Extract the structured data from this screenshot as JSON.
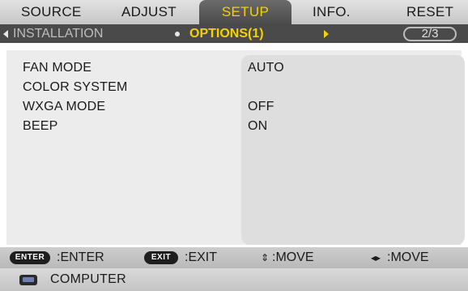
{
  "tabs": [
    {
      "label": "SOURCE",
      "active": false
    },
    {
      "label": "ADJUST",
      "active": false
    },
    {
      "label": "SETUP",
      "active": true
    },
    {
      "label": "INFO.",
      "active": false
    },
    {
      "label": "RESET",
      "active": false
    }
  ],
  "subtabs": {
    "prev": "INSTALLATION",
    "current": "OPTIONS(1)",
    "page": "2/3"
  },
  "settings": [
    {
      "label": "FAN MODE",
      "value": "AUTO"
    },
    {
      "label": "COLOR SYSTEM",
      "value": ""
    },
    {
      "label": "WXGA MODE",
      "value": "OFF"
    },
    {
      "label": "BEEP",
      "value": "ON"
    }
  ],
  "hints": {
    "enter_key": "ENTER",
    "enter_text": ":ENTER",
    "exit_key": "EXIT",
    "exit_text": ":EXIT",
    "move_vertical_text": ":MOVE",
    "move_horizontal_text": ":MOVE"
  },
  "source": {
    "icon": "monitor-icon",
    "label": "COMPUTER"
  },
  "colors": {
    "active_tab_text": "#f2d200",
    "active_tab_bg": "#4a4a4a"
  }
}
